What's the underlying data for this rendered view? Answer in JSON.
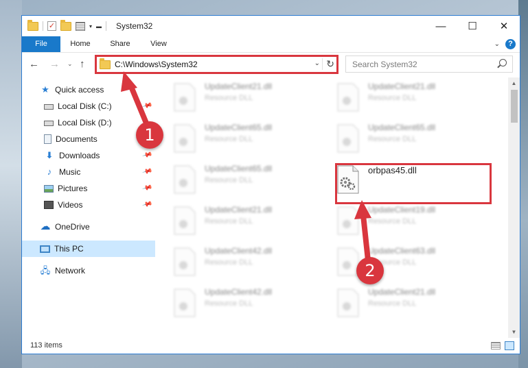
{
  "window": {
    "title": "System32",
    "controls": {
      "minimize": "—",
      "maximize": "☐",
      "close": "✕"
    }
  },
  "ribbon": {
    "tabs": [
      {
        "label": "File"
      },
      {
        "label": "Home"
      },
      {
        "label": "Share"
      },
      {
        "label": "View"
      }
    ],
    "help": "?",
    "expand": "⌄"
  },
  "navigation": {
    "back": "←",
    "forward": "→",
    "recent": "⌄",
    "up": "↑",
    "address": "C:\\Windows\\System32",
    "search_placeholder": "Search System32"
  },
  "sidebar": {
    "items": [
      {
        "label": "Quick access"
      },
      {
        "label": "Local Disk (C:)"
      },
      {
        "label": "Local Disk (D:)"
      },
      {
        "label": "Documents"
      },
      {
        "label": "Downloads"
      },
      {
        "label": "Music"
      },
      {
        "label": "Pictures"
      },
      {
        "label": "Videos"
      },
      {
        "label": "OneDrive"
      },
      {
        "label": "This PC"
      },
      {
        "label": "Network"
      }
    ]
  },
  "files": [
    {
      "name": "UpdateClient21.dll",
      "type": "Resource DLL"
    },
    {
      "name": "UpdateClient21.dll",
      "type": "Resource DLL"
    },
    {
      "name": "UpdateClient65.dll",
      "type": "Resource DLL"
    },
    {
      "name": "UpdateClient65.dll",
      "type": "Resource DLL"
    },
    {
      "name": "UpdateClient65.dll",
      "type": "Resource DLL"
    },
    {
      "name": "orbpas45.dll",
      "type": ""
    },
    {
      "name": "UpdateClient21.dll",
      "type": "Resource DLL"
    },
    {
      "name": "UpdateClient19.dll",
      "type": "Resource DLL"
    },
    {
      "name": "UpdateClient42.dll",
      "type": "Resource DLL"
    },
    {
      "name": "UpdateClient63.dll",
      "type": "Resource DLL"
    },
    {
      "name": "UpdateClient42.dll",
      "type": "Resource DLL"
    },
    {
      "name": "UpdateClient21.dll",
      "type": "Resource DLL"
    }
  ],
  "status": {
    "item_count": "113 items"
  },
  "annotations": {
    "step1": "1",
    "step2": "2",
    "accent_color": "#d9363e"
  }
}
